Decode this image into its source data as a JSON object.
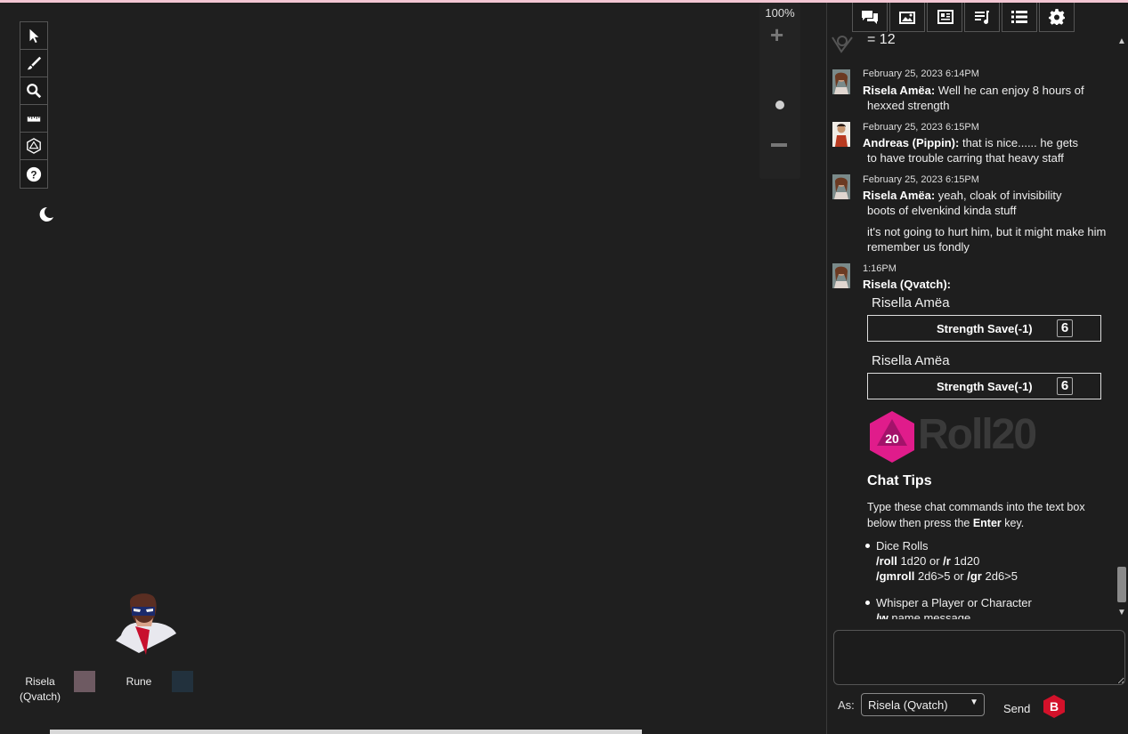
{
  "canvas": {
    "zoom_level": "100%",
    "players": [
      {
        "name": "Risela\n(Qvatch)",
        "color": "#6e5a62"
      },
      {
        "name": "Rune",
        "color": "#22313d"
      }
    ]
  },
  "toolbar": {
    "tools": [
      "select-tool",
      "draw-tool",
      "zoom-tool",
      "measure-tool",
      "dice-tool",
      "help-tool"
    ]
  },
  "tabs": [
    "chat-tab",
    "art-library-tab",
    "journal-tab",
    "jukebox-tab",
    "collections-tab",
    "settings-tab"
  ],
  "chat": {
    "partial_top": "= 12",
    "messages": [
      {
        "time": "February 25, 2023 6:14PM",
        "speaker": "Risela Amëa:",
        "text": "Well he can enjoy 8 hours of",
        "cont": "hexxed strength"
      },
      {
        "time": "February 25, 2023 6:15PM",
        "speaker": "Andreas (Pippin):",
        "text": "that is nice...... he gets",
        "cont": "to have trouble carring that heavy staff"
      },
      {
        "time": "February 25, 2023 6:15PM",
        "speaker": "Risela Amëa:",
        "text": "yeah, cloak of invisibility",
        "cont": "boots of elvenkind kinda stuff",
        "extra": "it's not going to hurt him, but it might make him remember us fondly"
      },
      {
        "time": "1:16PM",
        "speaker": "Risela (Qvatch):",
        "text": ""
      }
    ],
    "rolls": [
      {
        "character": "Risella Amëa",
        "label": "Strength Save(-1)",
        "value": "6"
      },
      {
        "character": "Risella Amëa",
        "label": "Strength Save(-1)",
        "value": "6"
      }
    ],
    "logo_text": "Roll20",
    "tips": {
      "title": "Chat Tips",
      "intro_a": "Type these chat commands into the text box below then press the ",
      "intro_key": "Enter",
      "intro_b": " key.",
      "items": [
        {
          "heading": "Dice Rolls",
          "cmd1": "/roll",
          "arg1": " 1d20 or ",
          "cmd2": "/r",
          "arg2": " 1d20",
          "cmd3": "/gmroll",
          "arg3": " 2d6>5 or ",
          "cmd4": "/gr",
          "arg4": " 2d6>5"
        },
        {
          "heading": "Whisper a Player or Character",
          "cmd1": "/w",
          "arg1": " name message"
        }
      ]
    },
    "input_placeholder": "",
    "as_label": "As:",
    "as_value": "Risela (Qvatch)",
    "send_label": "Send"
  }
}
